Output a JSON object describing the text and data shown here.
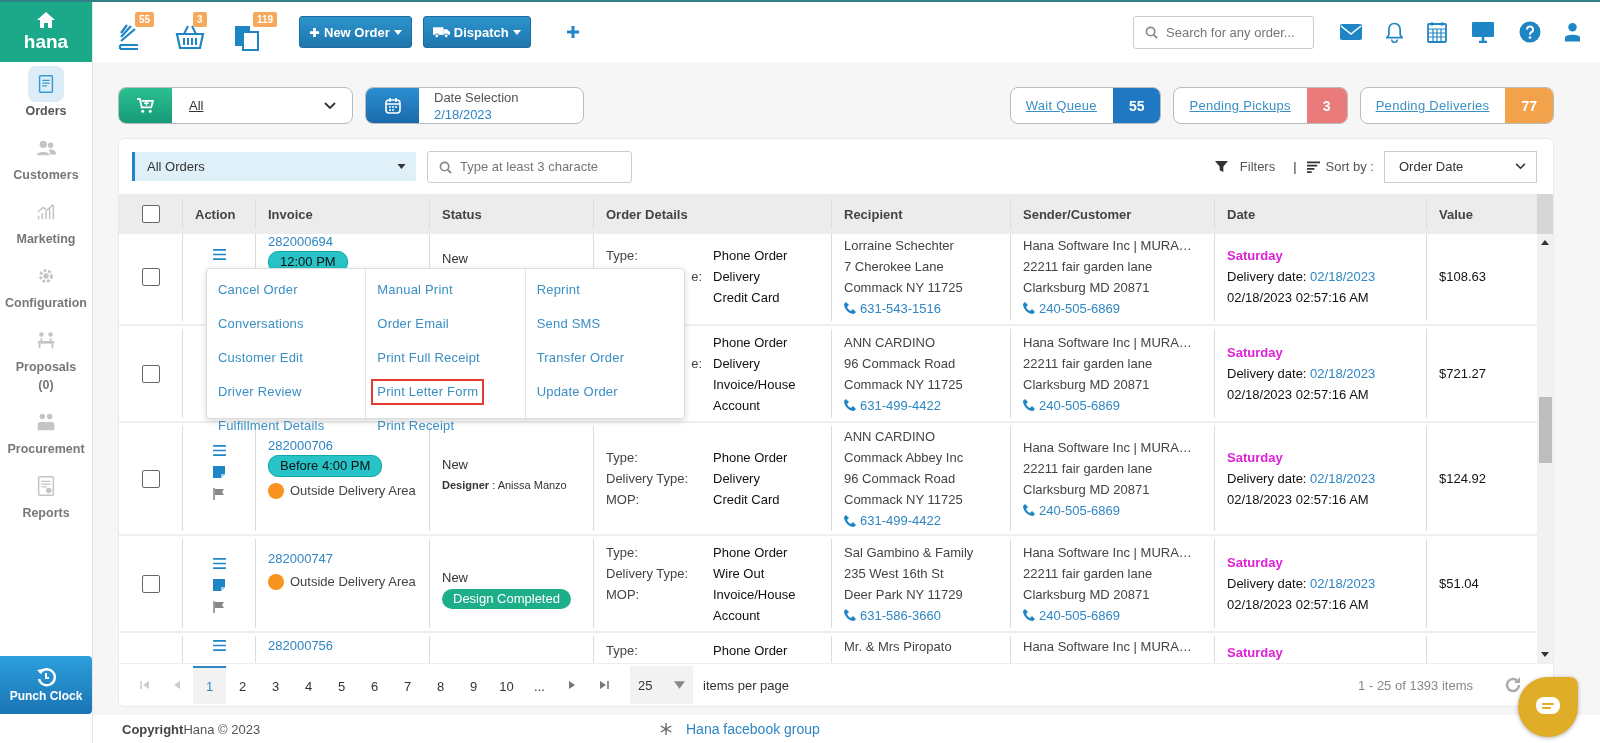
{
  "brand": {
    "name": "hana"
  },
  "sidebar": {
    "items": [
      {
        "label": "Orders",
        "selected": true
      },
      {
        "label": "Customers",
        "selected": false
      },
      {
        "label": "Marketing",
        "selected": false
      },
      {
        "label": "Configuration",
        "selected": false
      },
      {
        "label": "Proposals",
        "count": "(0)",
        "selected": false
      },
      {
        "label": "Procurement",
        "selected": false
      },
      {
        "label": "Reports",
        "selected": false
      }
    ],
    "punch_clock": "Punch Clock"
  },
  "header": {
    "counters": [
      {
        "badge": "55"
      },
      {
        "badge": "3"
      },
      {
        "badge": "119"
      }
    ],
    "actions": [
      {
        "label": "New Order"
      },
      {
        "label": "Dispatch"
      }
    ],
    "search": {
      "placeholder": "Search for any order..."
    }
  },
  "filters": {
    "order_type": "All",
    "date": {
      "label": "Date Selection",
      "value": "2/18/2023"
    },
    "queues": [
      {
        "label": "Wait Queue",
        "count": "55",
        "color": "#1f78c1"
      },
      {
        "label": "Pending Pickups",
        "count": "3",
        "color": "#ea7b7b"
      },
      {
        "label": "Pending Deliveries",
        "count": "77",
        "color": "#f2a24b"
      }
    ]
  },
  "list_toolbar": {
    "view": "All Orders",
    "search_placeholder": "Type at least 3 characte",
    "filters": "Filters",
    "separator": "|",
    "sort_label": "Sort by :",
    "sort_value": "Order Date"
  },
  "table": {
    "select_all": {
      "checked": false
    },
    "columns": [
      "Action",
      "Invoice",
      "Status",
      "Order Details",
      "Recipient",
      "Sender/Customer",
      "Date",
      "Value"
    ],
    "rows": [
      {
        "checked": false,
        "invoice": "282000694",
        "badge": "12:00 PM",
        "status": "New",
        "details": [
          {
            "label": "Type:",
            "value": "Phone Order"
          },
          {
            "label": "e:",
            "clipped": true,
            "value": "Delivery"
          },
          {
            "value": "Credit Card"
          }
        ],
        "recipient": [
          "Lorraine Schechter",
          "7 Cherokee Lane",
          "Commack NY 11725"
        ],
        "recipient_phone": "631-543-1516",
        "sender": [
          "Hana Software Inc | MURA…",
          "22211 fair garden lane",
          "Clarksburg MD 20871"
        ],
        "sender_phone": "240-505-6869",
        "date": {
          "day": "Saturday",
          "delivery_label": "Delivery date:",
          "delivery_date": "02/18/2023",
          "created": "02/18/2023 02:57:16 AM"
        },
        "value": "$108.63"
      },
      {
        "checked": false,
        "details": [
          {
            "value": "Phone Order"
          },
          {
            "label": "e:",
            "clipped": true,
            "value": "Delivery"
          },
          {
            "value": "Invoice/House Account"
          }
        ],
        "recipient": [
          "ANN CARDINO",
          "96 Commack Road",
          "Commack NY 11725"
        ],
        "recipient_phone": "631-499-4422",
        "sender": [
          "Hana Software Inc | MURA…",
          "22211 fair garden lane",
          "Clarksburg MD 20871"
        ],
        "sender_phone": "240-505-6869",
        "date": {
          "day": "Saturday",
          "delivery_label": "Delivery date:",
          "delivery_date": "02/18/2023",
          "created": "02/18/2023 02:57:16 AM"
        },
        "value": "$721.27"
      },
      {
        "checked": false,
        "invoice": "282000706",
        "badge": "Before 4:00 PM",
        "zone": "Outside Delivery Area",
        "status": "New",
        "designer": "**Designer** : Anissa Manzo",
        "details": [
          {
            "label": "Type:",
            "value": "Phone Order"
          },
          {
            "label": "Delivery Type:",
            "value": "Delivery"
          },
          {
            "label": "MOP:",
            "value": "Credit Card"
          }
        ],
        "recipient": [
          "ANN CARDINO",
          "Commack Abbey Inc",
          "96 Commack Road",
          "Commack NY 11725"
        ],
        "recipient_phone": "631-499-4422",
        "sender": [
          "Hana Software Inc | MURA…",
          "22211 fair garden lane",
          "Clarksburg MD 20871"
        ],
        "sender_phone": "240-505-6869",
        "date": {
          "day": "Saturday",
          "delivery_label": "Delivery date:",
          "delivery_date": "02/18/2023",
          "created": "02/18/2023 02:57:16 AM"
        },
        "value": "$124.92"
      },
      {
        "checked": false,
        "invoice": "282000747",
        "zone": "Outside Delivery Area",
        "status": "New",
        "status_badge": "Design Completed",
        "details": [
          {
            "label": "Type:",
            "value": "Phone Order"
          },
          {
            "label": "Delivery Type:",
            "value": "Wire Out"
          },
          {
            "label": "MOP:",
            "value": "Invoice/House Account"
          }
        ],
        "recipient": [
          "Sal Gambino & Family",
          "235 West 16th St",
          "Deer Park NY 11729"
        ],
        "recipient_phone": "631-586-3660",
        "sender": [
          "Hana Software Inc | MURA…",
          "22211 fair garden lane",
          "Clarksburg MD 20871"
        ],
        "sender_phone": "240-505-6869",
        "date": {
          "day": "Saturday",
          "delivery_label": "Delivery date:",
          "delivery_date": "02/18/2023",
          "created": "02/18/2023 02:57:16 AM"
        },
        "value": "$51.04"
      },
      {
        "invoice": "282000756",
        "details": [
          {
            "label": "Type:",
            "value": "Phone Order"
          }
        ],
        "recipient": [
          "Mr. & Mrs Piropato"
        ],
        "sender": [
          "Hana Software Inc | MURA…"
        ],
        "date": {
          "day": "Saturday"
        }
      }
    ]
  },
  "row_menu": {
    "columns": [
      [
        {
          "label": "Cancel Order",
          "selected": false
        },
        {
          "label": "Conversations",
          "selected": false
        },
        {
          "label": "Customer Edit",
          "selected": false
        },
        {
          "label": "Driver Review",
          "selected": false
        },
        {
          "label": "Fulfillment Details",
          "selected": false
        }
      ],
      [
        {
          "label": "Manual Print",
          "selected": false
        },
        {
          "label": "Order Email",
          "selected": false
        },
        {
          "label": "Print Full Receipt",
          "selected": false
        },
        {
          "label": "Print Letter Form",
          "selected": true
        },
        {
          "label": "Print Receipt",
          "selected": false
        }
      ],
      [
        {
          "label": "Reprint",
          "selected": false
        },
        {
          "label": "Send SMS",
          "selected": false
        },
        {
          "label": "Transfer Order",
          "selected": false
        },
        {
          "label": "Update Order",
          "selected": false
        }
      ]
    ]
  },
  "pagination": {
    "pages": [
      {
        "label": "1",
        "selected": true
      },
      {
        "label": "2",
        "selected": false
      },
      {
        "label": "3",
        "selected": false
      },
      {
        "label": "4",
        "selected": false
      },
      {
        "label": "5",
        "selected": false
      },
      {
        "label": "6",
        "selected": false
      },
      {
        "label": "7",
        "selected": false
      },
      {
        "label": "8",
        "selected": false
      },
      {
        "label": "9",
        "selected": false
      },
      {
        "label": "10",
        "selected": false
      },
      {
        "label": "...",
        "selected": false
      }
    ],
    "page_size": "25",
    "page_size_label": "items per page",
    "summary": "1 - 25 of 1393 items"
  },
  "footer": {
    "copyright": "**Copyright**Hana © 2023",
    "link": "Hana facebook group"
  }
}
